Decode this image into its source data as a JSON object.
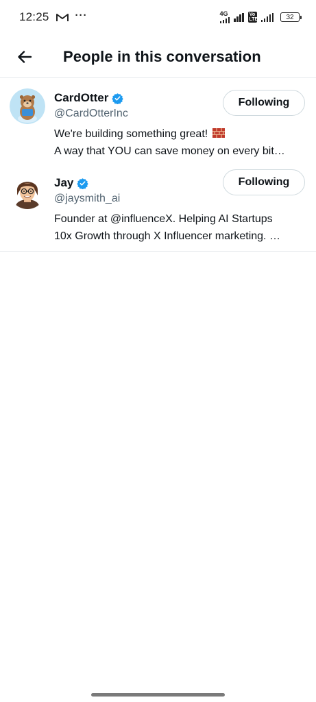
{
  "status_bar": {
    "time": "12:25",
    "network_label": "4G",
    "volte_label": "Vo LTE",
    "battery": "32"
  },
  "header": {
    "title": "People in this conversation"
  },
  "people": [
    {
      "name": "CardOtter",
      "handle": "@CardOtterInc",
      "bio_line1": "We're building something great!",
      "bio_line2": "A way that YOU can save money on every bit…",
      "follow_label": "Following"
    },
    {
      "name": "Jay",
      "handle": "@jaysmith_ai",
      "bio_line1": "Founder at @influenceX. Helping AI Startups",
      "bio_line2": "10x Growth through X Influencer marketing. …",
      "follow_label": "Following"
    }
  ],
  "colors": {
    "verified": "#1d9bf0",
    "secondary_text": "#536471",
    "divider": "#e6e9ec"
  }
}
